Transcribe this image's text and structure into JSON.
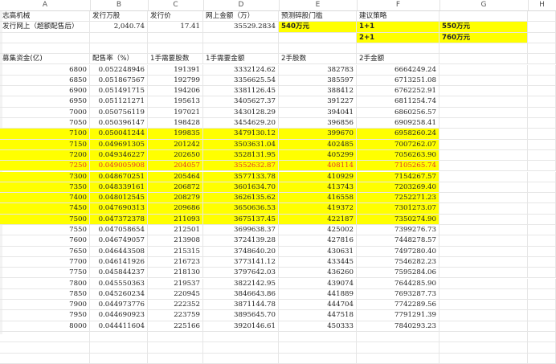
{
  "columns": [
    "A",
    "B",
    "C",
    "D",
    "E",
    "F",
    "G",
    "H"
  ],
  "top": {
    "r1": [
      "志高机械",
      "发行万股",
      "发行价",
      "网上金额（万）",
      "预测碎股门槛",
      "建议策略",
      "",
      ""
    ],
    "r2": [
      "发行网上（超额配售后）",
      "2,040.74",
      "17.41",
      "35529.2834",
      "540万元",
      "1+1",
      "550万元",
      ""
    ],
    "r3": [
      "",
      "",
      "",
      "",
      "",
      "2+1",
      "760万元",
      ""
    ]
  },
  "table_header": [
    "募集资金(亿)",
    "配售率（%）",
    "1手需要股数",
    "1手需要金额",
    "2手股数",
    "2手金额",
    "",
    ""
  ],
  "rows": [
    {
      "a": "6800",
      "b": "0.052248946",
      "c": "191391",
      "d": "3332124.62",
      "e": "382783",
      "f": "6664249.24",
      "hl": false,
      "red": false
    },
    {
      "a": "6850",
      "b": "0.051867567",
      "c": "192799",
      "d": "3356625.54",
      "e": "385597",
      "f": "6713251.08",
      "hl": false,
      "red": false
    },
    {
      "a": "6900",
      "b": "0.051491715",
      "c": "194206",
      "d": "3381126.45",
      "e": "388412",
      "f": "6762252.91",
      "hl": false,
      "red": false
    },
    {
      "a": "6950",
      "b": "0.051121271",
      "c": "195613",
      "d": "3405627.37",
      "e": "391227",
      "f": "6811254.74",
      "hl": false,
      "red": false
    },
    {
      "a": "7000",
      "b": "0.050756119",
      "c": "197021",
      "d": "3430128.29",
      "e": "394041",
      "f": "6860256.57",
      "hl": false,
      "red": false
    },
    {
      "a": "7050",
      "b": "0.050396147",
      "c": "198428",
      "d": "3454629.20",
      "e": "396856",
      "f": "6909258.41",
      "hl": false,
      "red": false
    },
    {
      "a": "7100",
      "b": "0.050041244",
      "c": "199835",
      "d": "3479130.12",
      "e": "399670",
      "f": "6958260.24",
      "hl": true,
      "red": false
    },
    {
      "a": "7150",
      "b": "0.049691305",
      "c": "201242",
      "d": "3503631.04",
      "e": "402485",
      "f": "7007262.07",
      "hl": true,
      "red": false
    },
    {
      "a": "7200",
      "b": "0.049346227",
      "c": "202650",
      "d": "3528131.95",
      "e": "405299",
      "f": "7056263.90",
      "hl": true,
      "red": false
    },
    {
      "a": "7250",
      "b": "0.049005908",
      "c": "204057",
      "d": "3552632.87",
      "e": "408114",
      "f": "7105265.74",
      "hl": true,
      "red": true
    },
    {
      "a": "7300",
      "b": "0.048670251",
      "c": "205464",
      "d": "3577133.78",
      "e": "410929",
      "f": "7154267.57",
      "hl": true,
      "red": false
    },
    {
      "a": "7350",
      "b": "0.048339161",
      "c": "206872",
      "d": "3601634.70",
      "e": "413743",
      "f": "7203269.40",
      "hl": true,
      "red": false
    },
    {
      "a": "7400",
      "b": "0.048012545",
      "c": "208279",
      "d": "3626135.62",
      "e": "416558",
      "f": "7252271.23",
      "hl": true,
      "red": false
    },
    {
      "a": "7450",
      "b": "0.047690313",
      "c": "209686",
      "d": "3650636.53",
      "e": "419372",
      "f": "7301273.07",
      "hl": true,
      "red": false
    },
    {
      "a": "7500",
      "b": "0.047372378",
      "c": "211093",
      "d": "3675137.45",
      "e": "422187",
      "f": "7350274.90",
      "hl": true,
      "red": false
    },
    {
      "a": "7550",
      "b": "0.047058654",
      "c": "212501",
      "d": "3699638.37",
      "e": "425002",
      "f": "7399276.73",
      "hl": false,
      "red": false
    },
    {
      "a": "7600",
      "b": "0.046749057",
      "c": "213908",
      "d": "3724139.28",
      "e": "427816",
      "f": "7448278.57",
      "hl": false,
      "red": false
    },
    {
      "a": "7650",
      "b": "0.046443508",
      "c": "215315",
      "d": "3748640.20",
      "e": "430631",
      "f": "7497280.40",
      "hl": false,
      "red": false
    },
    {
      "a": "7700",
      "b": "0.046141926",
      "c": "216723",
      "d": "3773141.12",
      "e": "433445",
      "f": "7546282.23",
      "hl": false,
      "red": false
    },
    {
      "a": "7750",
      "b": "0.045844237",
      "c": "218130",
      "d": "3797642.03",
      "e": "436260",
      "f": "7595284.06",
      "hl": false,
      "red": false
    },
    {
      "a": "7800",
      "b": "0.045550363",
      "c": "219537",
      "d": "3822142.95",
      "e": "439074",
      "f": "7644285.90",
      "hl": false,
      "red": false
    },
    {
      "a": "7850",
      "b": "0.045260234",
      "c": "220945",
      "d": "3846643.86",
      "e": "441889",
      "f": "7693287.73",
      "hl": false,
      "red": false
    },
    {
      "a": "7900",
      "b": "0.044973776",
      "c": "222352",
      "d": "3871144.78",
      "e": "444704",
      "f": "7742289.56",
      "hl": false,
      "red": false
    },
    {
      "a": "7950",
      "b": "0.044690923",
      "c": "223759",
      "d": "3895645.70",
      "e": "447518",
      "f": "7791291.39",
      "hl": false,
      "red": false
    },
    {
      "a": "8000",
      "b": "0.044411604",
      "c": "225166",
      "d": "3920146.61",
      "e": "450333",
      "f": "7840293.23",
      "hl": false,
      "red": false
    }
  ],
  "colors": {
    "highlight": "#ffff00",
    "red_text": "#e0392b",
    "grid": "#e6e6e6"
  }
}
